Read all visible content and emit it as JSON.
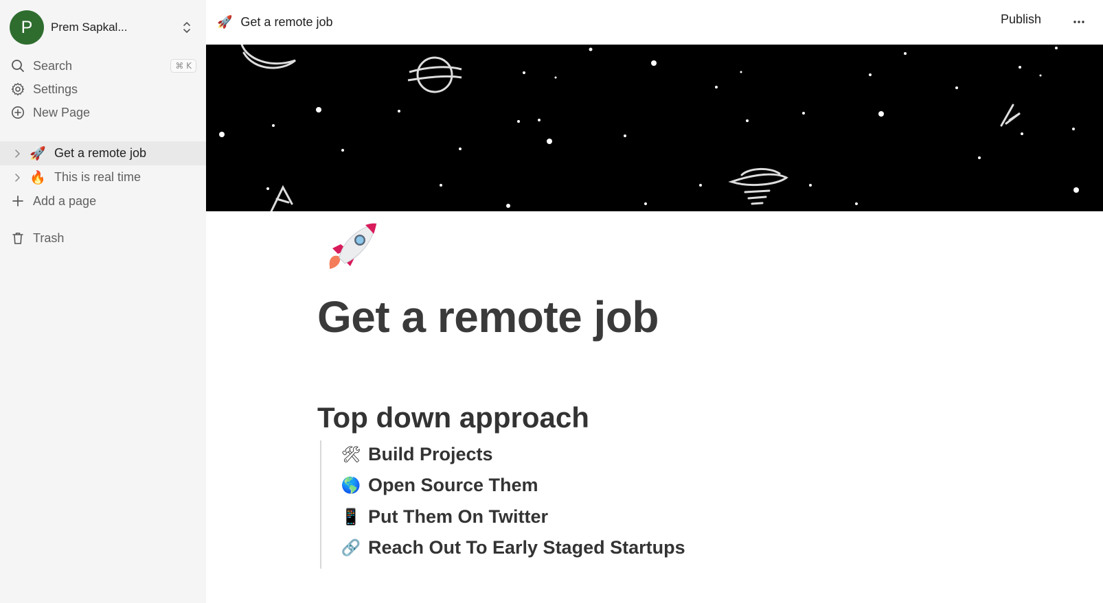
{
  "workspace": {
    "avatar_letter": "P",
    "name": "Prem Sapkal..."
  },
  "nav": {
    "search": {
      "label": "Search",
      "shortcut": "⌘ K"
    },
    "settings": {
      "label": "Settings"
    },
    "new_page": {
      "label": "New Page"
    }
  },
  "pages": [
    {
      "emoji": "🚀",
      "label": "Get a remote job",
      "active": true
    },
    {
      "emoji": "🔥",
      "label": "This is real time",
      "active": false
    }
  ],
  "add_page": {
    "label": "Add a page"
  },
  "trash": {
    "label": "Trash"
  },
  "topbar": {
    "emoji": "🚀",
    "breadcrumb": "Get a remote job",
    "publish": "Publish"
  },
  "document": {
    "icon": "rocket-icon",
    "title": "Get a remote job",
    "heading": "Top down approach",
    "items": [
      {
        "emoji": "🛠",
        "text": "Build Projects"
      },
      {
        "emoji": "🌎",
        "text": "Open Source Them"
      },
      {
        "emoji": "📱",
        "text": "Put Them On Twitter"
      },
      {
        "emoji": "🔗",
        "text": "Reach Out To Early Staged Startups"
      }
    ]
  },
  "colors": {
    "avatar": "#2f6d2f",
    "sidebar_bg": "#f5f5f5",
    "active_item_bg": "#e9e9e9",
    "cover_bg": "#000000"
  }
}
